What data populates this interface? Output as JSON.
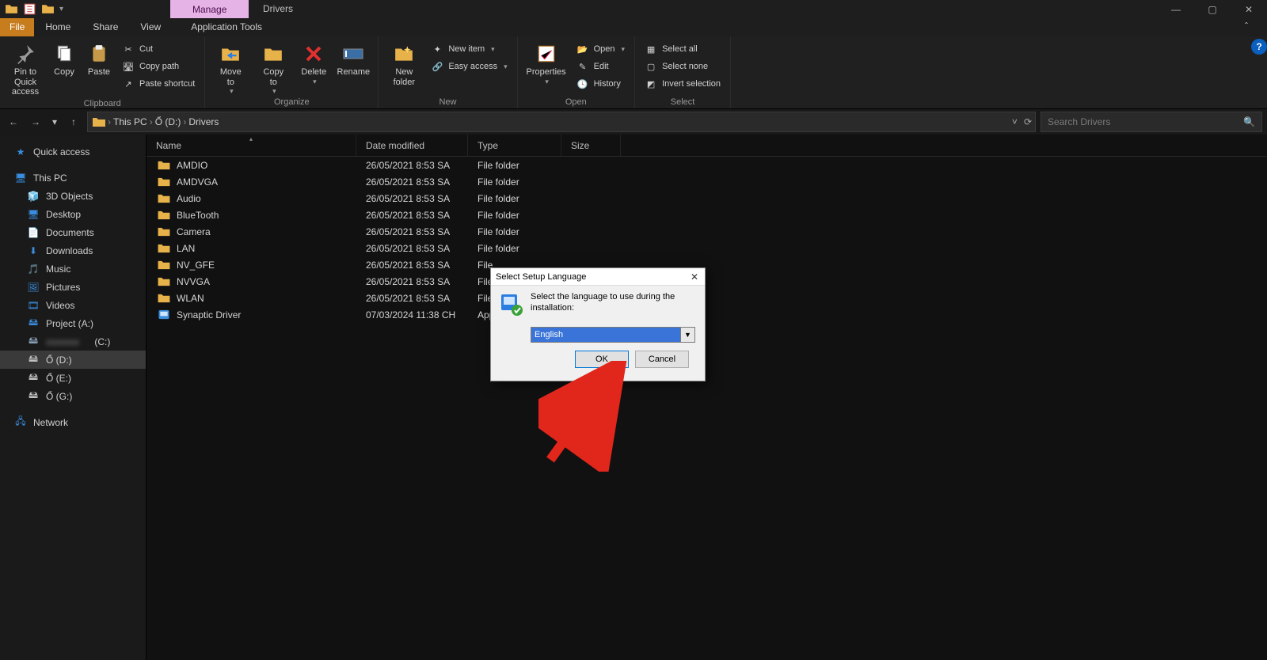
{
  "window": {
    "contextual_tab": "Manage",
    "title": "Drivers",
    "min": "—",
    "max": "▢",
    "close": "✕"
  },
  "tabs": {
    "file": "File",
    "home": "Home",
    "share": "Share",
    "view": "View",
    "app_tools": "Application Tools"
  },
  "ribbon": {
    "clipboard": {
      "pin_quick": "Pin to Quick\naccess",
      "copy": "Copy",
      "paste": "Paste",
      "cut": "Cut",
      "copy_path": "Copy path",
      "paste_shortcut": "Paste shortcut",
      "label": "Clipboard"
    },
    "organize": {
      "move_to": "Move\nto",
      "copy_to": "Copy\nto",
      "delete": "Delete",
      "rename": "Rename",
      "label": "Organize"
    },
    "new": {
      "new_folder": "New\nfolder",
      "new_item": "New item",
      "easy_access": "Easy access",
      "label": "New"
    },
    "open": {
      "properties": "Properties",
      "open": "Open",
      "edit": "Edit",
      "history": "History",
      "label": "Open"
    },
    "select": {
      "select_all": "Select all",
      "select_none": "Select none",
      "invert": "Invert selection",
      "label": "Select"
    }
  },
  "breadcrumb": {
    "this_pc": "This PC",
    "drive": "Ổ (D:)",
    "folder": "Drivers"
  },
  "search": {
    "placeholder": "Search Drivers"
  },
  "sidebar": {
    "quick_access": "Quick access",
    "this_pc": "This PC",
    "items": [
      "3D Objects",
      "Desktop",
      "Documents",
      "Downloads",
      "Music",
      "Pictures",
      "Videos",
      "Project (A:)"
    ],
    "drive_c_blurred": "(C:)",
    "drives": [
      "Ổ (D:)",
      "Ổ (E:)",
      "Ổ (G:)"
    ],
    "network": "Network"
  },
  "columns": {
    "name": "Name",
    "date": "Date modified",
    "type": "Type",
    "size": "Size"
  },
  "rows": [
    {
      "name": "AMDIO",
      "date": "26/05/2021 8:53 SA",
      "type": "File folder",
      "app": false
    },
    {
      "name": "AMDVGA",
      "date": "26/05/2021 8:53 SA",
      "type": "File folder",
      "app": false
    },
    {
      "name": "Audio",
      "date": "26/05/2021 8:53 SA",
      "type": "File folder",
      "app": false
    },
    {
      "name": "BlueTooth",
      "date": "26/05/2021 8:53 SA",
      "type": "File folder",
      "app": false
    },
    {
      "name": "Camera",
      "date": "26/05/2021 8:53 SA",
      "type": "File folder",
      "app": false
    },
    {
      "name": "LAN",
      "date": "26/05/2021 8:53 SA",
      "type": "File folder",
      "app": false
    },
    {
      "name": "NV_GFE",
      "date": "26/05/2021 8:53 SA",
      "type": "File",
      "app": false,
      "truncated": true
    },
    {
      "name": "NVVGA",
      "date": "26/05/2021 8:53 SA",
      "type": "File",
      "app": false,
      "truncated": true
    },
    {
      "name": "WLAN",
      "date": "26/05/2021 8:53 SA",
      "type": "File",
      "app": false,
      "truncated": true
    },
    {
      "name": "Synaptic Driver",
      "date": "07/03/2024 11:38 CH",
      "type": "App",
      "app": true,
      "truncated": true
    }
  ],
  "dialog": {
    "title": "Select Setup Language",
    "text": "Select the language to use during the installation:",
    "selected": "English",
    "ok": "OK",
    "cancel": "Cancel"
  }
}
